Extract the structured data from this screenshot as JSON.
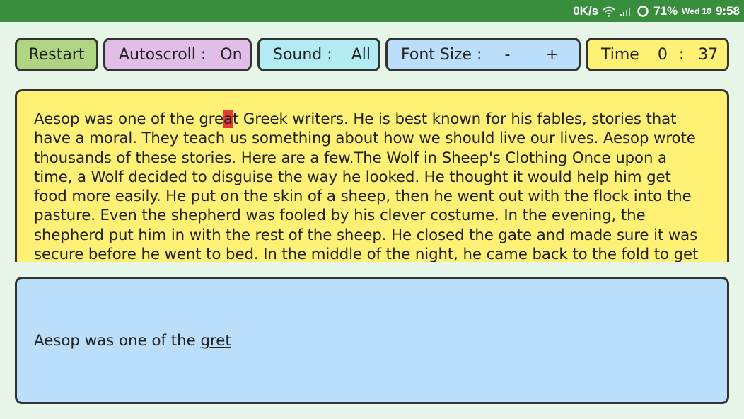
{
  "status_bar": {
    "speed": "0K/s",
    "battery": "71%",
    "date": "Wed 10",
    "time": "9:58",
    "icons": [
      "wifi-icon",
      "signal-icon",
      "battery-ring-icon"
    ]
  },
  "toolbar": {
    "restart_label": "Restart",
    "autoscroll_label": "Autoscroll :",
    "autoscroll_value": "On",
    "sound_label": "Sound :",
    "sound_value": "All",
    "fontsize_label": "Font Size :",
    "fontsize_minus": "-",
    "fontsize_plus": "+",
    "time_label": "Time",
    "time_minutes": "0",
    "time_sep": ":",
    "time_seconds": "37"
  },
  "story": {
    "before_cursor": "Aesop was one of the gre",
    "cursor_char": "a",
    "after_cursor": "t Greek writers. He is best known for his fables, stories that have a moral. They teach us something about how we should live our lives. Aesop wrote thousands of these stories. Here are a few.The Wolf in Sheep's Clothing Once upon a time, a Wolf decided to disguise the way he looked. He thought it would help him get food more easily. He put on the skin of a sheep, then he went out with the flock into the pasture. Even the shepherd was fooled by his clever costume. In the evening, the shepherd put him in with the rest of the sheep. He closed the gate and made sure it was secure before he went to bed. In the middle of the night, he came back to the fold to get some meat for the next"
  },
  "typed": {
    "correct": "Aesop was one of the ",
    "current_word": "gret"
  },
  "colors": {
    "background": "#e8f5e9",
    "status_bar": "#388e3c",
    "restart": "#aed581",
    "autoscroll": "#e1bee7",
    "sound": "#b2ebf2",
    "font_size": "#bbdefb",
    "time": "#fff176",
    "cursor_highlight": "#e53935"
  }
}
